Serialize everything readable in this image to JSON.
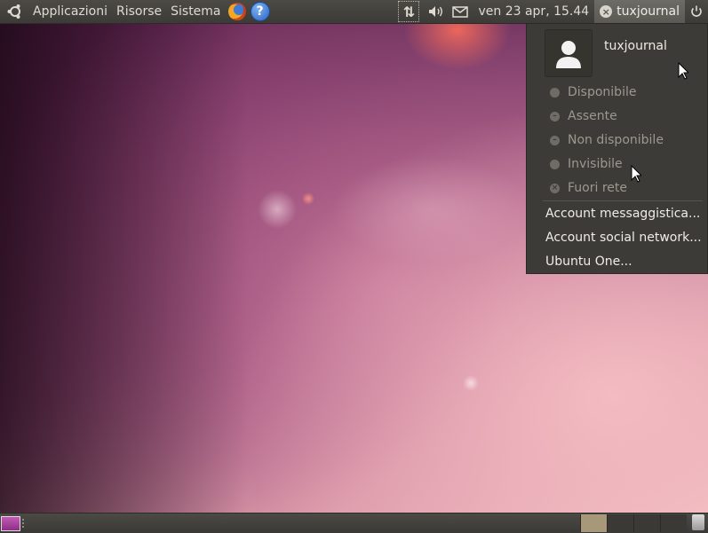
{
  "top_panel": {
    "menus": [
      "Applicazioni",
      "Risorse",
      "Sistema"
    ],
    "help_glyph": "?",
    "clock": "ven 23 apr, 15.44",
    "username": "tuxjournal",
    "icons": [
      "ubuntu-logo-icon",
      "firefox-icon",
      "help-icon",
      "network-icon",
      "volume-icon",
      "mail-icon",
      "power-icon"
    ]
  },
  "me_menu": {
    "username": "tuxjournal",
    "statuses": [
      {
        "label": "Disponibile",
        "glyph": ""
      },
      {
        "label": "Assente",
        "glyph": "–"
      },
      {
        "label": "Non disponibile",
        "glyph": "–"
      },
      {
        "label": "Invisibile",
        "glyph": ""
      },
      {
        "label": "Fuori rete",
        "glyph": "×"
      }
    ],
    "actions": [
      "Account messaggistica...",
      "Account social network...",
      "Ubuntu One..."
    ]
  },
  "bottom_panel": {
    "workspaces": 4,
    "active_workspace": 1
  },
  "colors": {
    "panel": "#3c3b37",
    "panel_text": "#dfdbd2",
    "menu_bg": "#3c3b37",
    "disabled_text": "#9c988f",
    "active_workspace": "#a8987a"
  }
}
